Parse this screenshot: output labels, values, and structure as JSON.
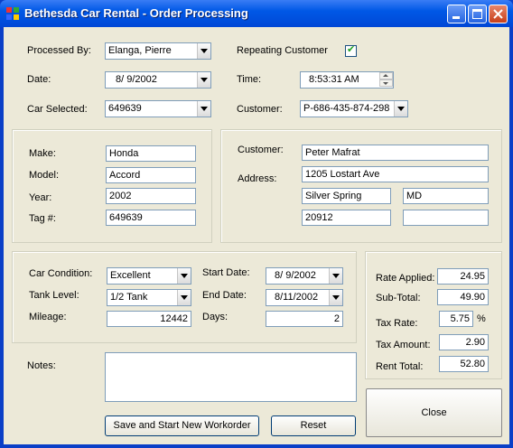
{
  "window": {
    "title": "Bethesda Car Rental - Order Processing"
  },
  "top": {
    "processed_by_label": "Processed By:",
    "processed_by_value": "Elanga, Pierre",
    "repeating_label": "Repeating Customer",
    "repeating_checked": true,
    "date_label": "Date:",
    "date_value": "8/  9/2002",
    "time_label": "Time:",
    "time_value": "8:53:31 AM",
    "car_label": "Car Selected:",
    "car_value": "649639",
    "customer_label": "Customer:",
    "customer_value": "P-686-435-874-298"
  },
  "car": {
    "make_label": "Make:",
    "make_value": "Honda",
    "model_label": "Model:",
    "model_value": "Accord",
    "year_label": "Year:",
    "year_value": "2002",
    "tag_label": "Tag #:",
    "tag_value": "649639"
  },
  "customer_info": {
    "customer_label": "Customer:",
    "customer_value": "Peter Mafrat",
    "address_label": "Address:",
    "address_value": "1205 Lostart Ave",
    "city_value": "Silver Spring",
    "state_value": "MD",
    "zip_value": "20912",
    "extra_value": ""
  },
  "rental": {
    "condition_label": "Car Condition:",
    "condition_value": "Excellent",
    "tank_label": "Tank Level:",
    "tank_value": "1/2 Tank",
    "mileage_label": "Mileage:",
    "mileage_value": "12442",
    "start_label": "Start Date:",
    "start_value": "8/  9/2002",
    "end_label": "End Date:",
    "end_value": "8/11/2002",
    "days_label": "Days:",
    "days_value": "2"
  },
  "totals": {
    "rate_label": "Rate Applied:",
    "rate_value": "24.95",
    "subtotal_label": "Sub-Total:",
    "subtotal_value": "49.90",
    "taxrate_label": "Tax Rate:",
    "taxrate_value": "5.75",
    "percent": "%",
    "taxamount_label": "Tax Amount:",
    "taxamount_value": "2.90",
    "total_label": "Rent Total:",
    "total_value": "52.80"
  },
  "notes": {
    "label": "Notes:",
    "value": ""
  },
  "buttons": {
    "save": "Save and Start New Workorder",
    "reset": "Reset",
    "close": "Close"
  }
}
